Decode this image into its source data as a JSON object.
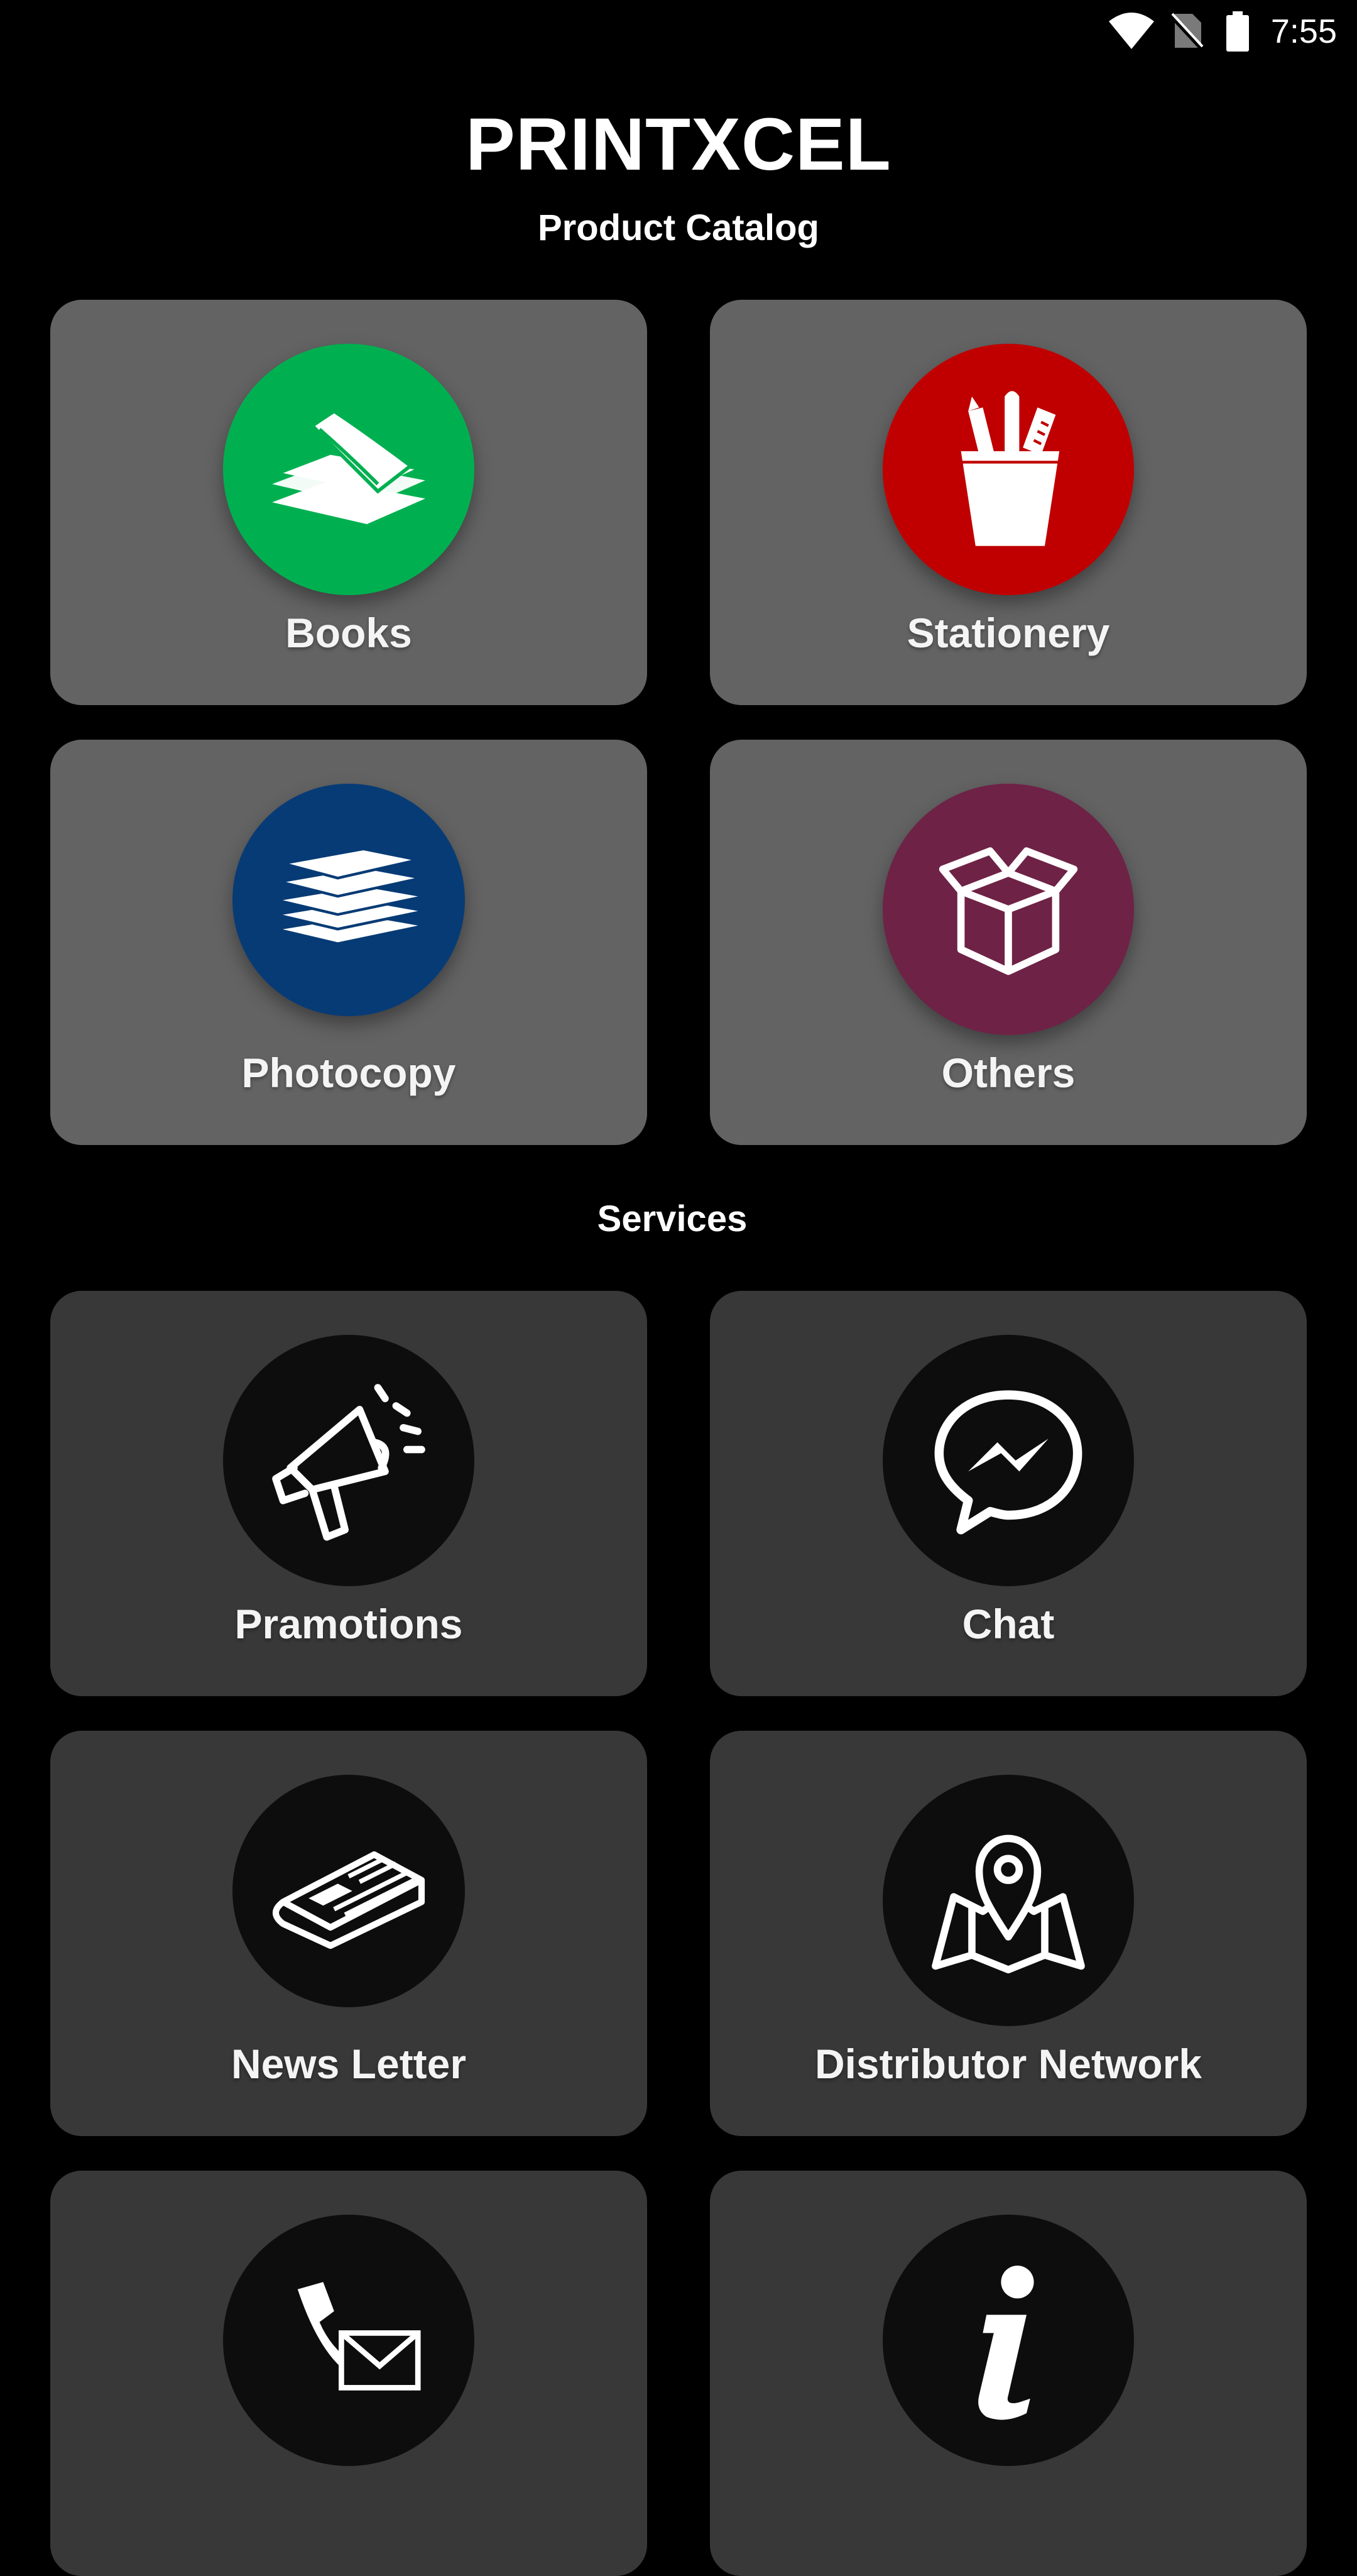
{
  "status_bar": {
    "time": "7:55",
    "icons": [
      "wifi-icon",
      "no-sim-icon",
      "battery-icon"
    ]
  },
  "header": {
    "app_title": "PRINTXCEL"
  },
  "catalog": {
    "title": "Product Catalog",
    "items": [
      {
        "label": "Books",
        "icon": "books-stack-icon",
        "color": "#00B050"
      },
      {
        "label": "Stationery",
        "icon": "pencil-cup-icon",
        "color": "#C00000"
      },
      {
        "label": "Photocopy",
        "icon": "paper-stack-icon",
        "color": "#073B75"
      },
      {
        "label": "Others",
        "icon": "open-box-icon",
        "color": "#6E2246"
      }
    ]
  },
  "services": {
    "title": "Services",
    "items": [
      {
        "label": "Pramotions",
        "icon": "megaphone-icon"
      },
      {
        "label": "Chat",
        "icon": "messenger-chat-icon"
      },
      {
        "label": "News Letter",
        "icon": "newspaper-icon"
      },
      {
        "label": "Distributor Network",
        "icon": "map-pin-icon"
      },
      {
        "label": "",
        "icon": "phone-email-icon"
      },
      {
        "label": "",
        "icon": "info-icon"
      }
    ]
  },
  "colors": {
    "background": "#000000",
    "catalog_tile": "#636363",
    "service_tile": "#383838",
    "service_circle": "#0D0D0D"
  }
}
